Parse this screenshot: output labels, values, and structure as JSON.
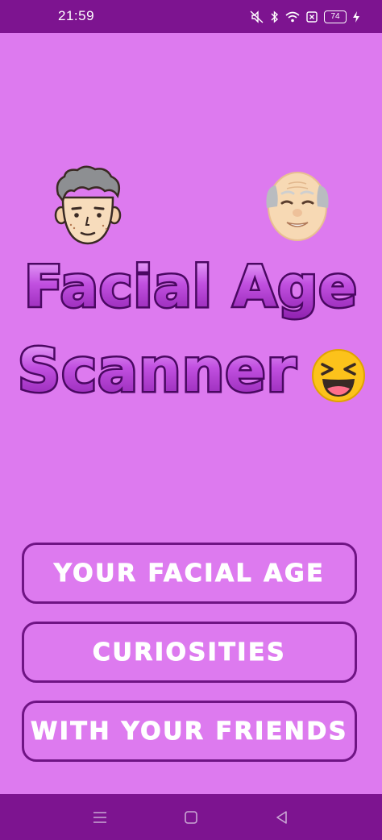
{
  "status_bar": {
    "time": "21:59",
    "battery_level": "74",
    "icons": [
      "mute-icon",
      "bluetooth-icon",
      "wifi-icon",
      "sim-off-icon",
      "battery-icon",
      "charging-icon"
    ]
  },
  "hero": {
    "title_line_1": "Facial Age",
    "title_line_2": "Scanner",
    "emojis": [
      "young-man-face-icon",
      "old-man-face-icon",
      "laughing-face-icon"
    ]
  },
  "menu": {
    "your_facial_age": "YOUR FACIAL AGE",
    "curiosities": "CURIOSITIES",
    "with_your_friends": "WITH YOUR FRIENDS"
  },
  "nav_bar": {
    "icons": [
      "menu-icon",
      "home-icon",
      "back-icon"
    ]
  },
  "colors": {
    "background": "#dd7aef",
    "bars": "#7d1490",
    "button_border": "#6f1484",
    "title_fill": "#b43ad2",
    "title_outline": "#4a0862"
  }
}
